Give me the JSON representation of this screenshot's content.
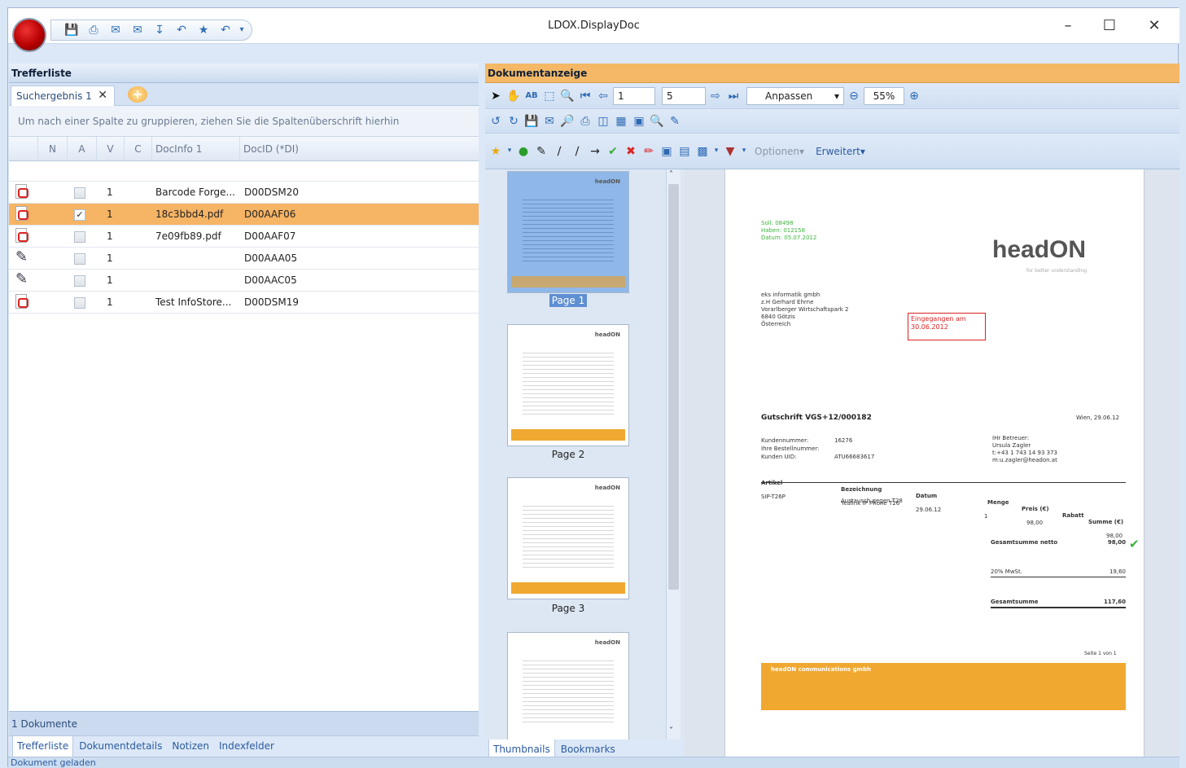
{
  "window": {
    "title": "LDOX.DisplayDoc"
  },
  "left_pane": {
    "header": "Trefferliste",
    "tab": "Suchergebnis 1",
    "group_hint": "Um nach einer Spalte zu gruppieren, ziehen Sie die Spaltenüberschrift hierhin",
    "columns": [
      "N",
      "A",
      "V",
      "C",
      "DocInfo 1",
      "DocID (*DI)"
    ],
    "rows": [
      {
        "icon": "pdf-icon",
        "checked": "",
        "v": "1",
        "info": "Barcode Forge...",
        "id": "D00DSM20"
      },
      {
        "icon": "pdf-icon",
        "checked": "✓",
        "v": "1",
        "info": "18c3bbd4.pdf",
        "id": "D00AAF06"
      },
      {
        "icon": "pdf-icon",
        "checked": "",
        "v": "1",
        "info": "7e09fb89.pdf",
        "id": "D00AAF07"
      },
      {
        "icon": "notes-icon",
        "checked": "",
        "v": "1",
        "info": "",
        "id": "D00AAA05"
      },
      {
        "icon": "notes-icon",
        "checked": "",
        "v": "1",
        "info": "",
        "id": "D00AAC05"
      },
      {
        "icon": "pdf-icon",
        "checked": "",
        "v": "1",
        "info": "Test InfoStore...",
        "id": "D00DSM19"
      }
    ],
    "count": "1 Dokumente",
    "bottom_tabs": [
      "Trefferliste",
      "Dokumentdetails",
      "Notizen",
      "Indexfelder"
    ]
  },
  "right_pane": {
    "header": "Dokumentanzeige",
    "page_current": "1",
    "page_total": "5",
    "fit_mode": "Anpassen",
    "zoom": "55%",
    "options_label": "Optionen",
    "advanced_label": "Erweitert",
    "thumbnails": [
      "Page 1",
      "Page 2",
      "Page 3"
    ],
    "bottom_tabs": [
      "Thumbnails",
      "Bookmarks"
    ]
  },
  "document": {
    "stamp_green": [
      "Soll: 08498",
      "Haben: 012158",
      "Datum: 05.07.2012"
    ],
    "logo": "headON",
    "logo_tag": "for better understanding",
    "address": [
      "eks informatik gmbh",
      "z.H Gerhard Ehrne",
      "Vorarlberger Wirtschaftspark 2",
      "6840 Götzis",
      "Österreich"
    ],
    "stamp_red": [
      "Eingegangen am",
      "30.06.2012"
    ],
    "heading": "Gutschrift VGS+12/000182",
    "date": "Wien, 29.06.12",
    "meta_left": [
      "Kundennummer:",
      "Ihre Bestellnummer:",
      "Kunden UID:"
    ],
    "meta_vals": [
      "16276",
      "",
      "ATU66683617"
    ],
    "meta_right": [
      "IHr Betreuer:",
      "Ursula Zagler",
      "t:+43 1 743 14 93 373",
      "m:u.zagler@headon.at"
    ],
    "table_head": [
      "Artikel",
      "Bezeichnung",
      "Datum",
      "Menge",
      "Preis (€)",
      "Rabatt",
      "Summe (€)"
    ],
    "table_row": [
      "SIP-T26P",
      "Yealink IP Phone T26",
      "29.06.12",
      "1",
      "98,00",
      "",
      "98,00"
    ],
    "table_row2": "Austausch gegen T28",
    "totals": [
      [
        "Gesamtsumme netto",
        "98,00"
      ],
      [
        "20% MwSt.",
        "19,60"
      ],
      [
        "Gesamtsumme",
        "117,60"
      ]
    ],
    "page_num": "Seite 1 von 1",
    "footer_company": "headON communications gmbh"
  },
  "status": {
    "text": "Dokument geladen"
  },
  "colors": {
    "accent": "#f6b465",
    "header_orange": "#f4b866",
    "pdf_red": "#d22222"
  }
}
